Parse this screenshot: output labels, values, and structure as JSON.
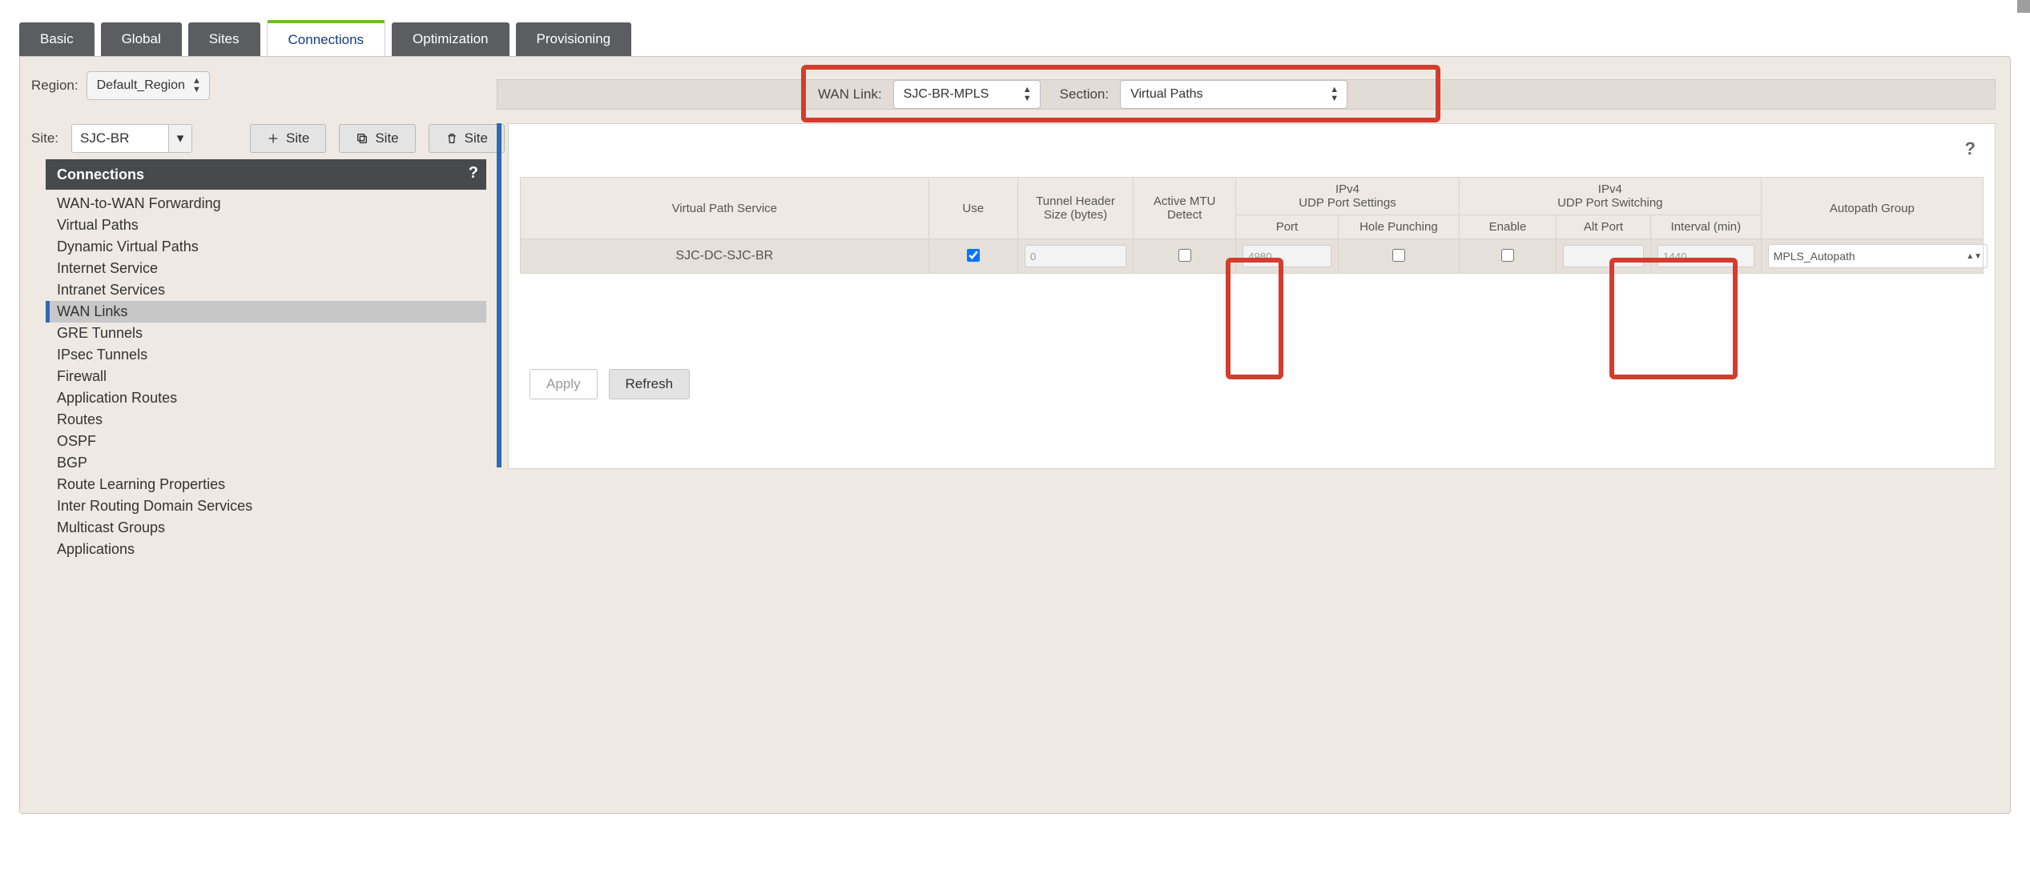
{
  "tabs": {
    "items": [
      "Basic",
      "Global",
      "Sites",
      "Connections",
      "Optimization",
      "Provisioning"
    ],
    "active_index": 3
  },
  "region": {
    "label": "Region:",
    "value": "Default_Region"
  },
  "site": {
    "label": "Site:",
    "value": "SJC-BR",
    "add_btn": "Site",
    "clone_btn": "Site",
    "delete_btn": "Site"
  },
  "wanbar": {
    "wan_label": "WAN Link:",
    "wan_value": "SJC-BR-MPLS",
    "section_label": "Section:",
    "section_value": "Virtual Paths"
  },
  "tree": {
    "header": "Connections",
    "items": [
      "WAN-to-WAN Forwarding",
      "Virtual Paths",
      "Dynamic Virtual Paths",
      "Internet Service",
      "Intranet Services",
      "WAN Links",
      "GRE Tunnels",
      "IPsec Tunnels",
      "Firewall",
      "Application Routes",
      "Routes",
      "OSPF",
      "BGP",
      "Route Learning Properties",
      "Inter Routing Domain Services",
      "Multicast Groups",
      "Applications"
    ],
    "selected_index": 5
  },
  "table": {
    "group_udp_settings": "IPv4\nUDP Port Settings",
    "group_udp_switching": "IPv4\nUDP Port Switching",
    "headers": {
      "svc": "Virtual Path Service",
      "use": "Use",
      "thz": "Tunnel Header Size (bytes)",
      "mtu": "Active MTU Detect",
      "port": "Port",
      "hole": "Hole Punching",
      "enable": "Enable",
      "alt": "Alt Port",
      "interval": "Interval (min)",
      "auto": "Autopath Group"
    },
    "row": {
      "svc": "SJC-DC-SJC-BR",
      "use": true,
      "thz": "0",
      "mtu": false,
      "port": "4980",
      "hole": false,
      "enable": false,
      "alt": "",
      "interval": "1440",
      "auto": "MPLS_Autopath"
    },
    "apply_btn": "Apply",
    "refresh_btn": "Refresh"
  },
  "help_glyph": "?"
}
